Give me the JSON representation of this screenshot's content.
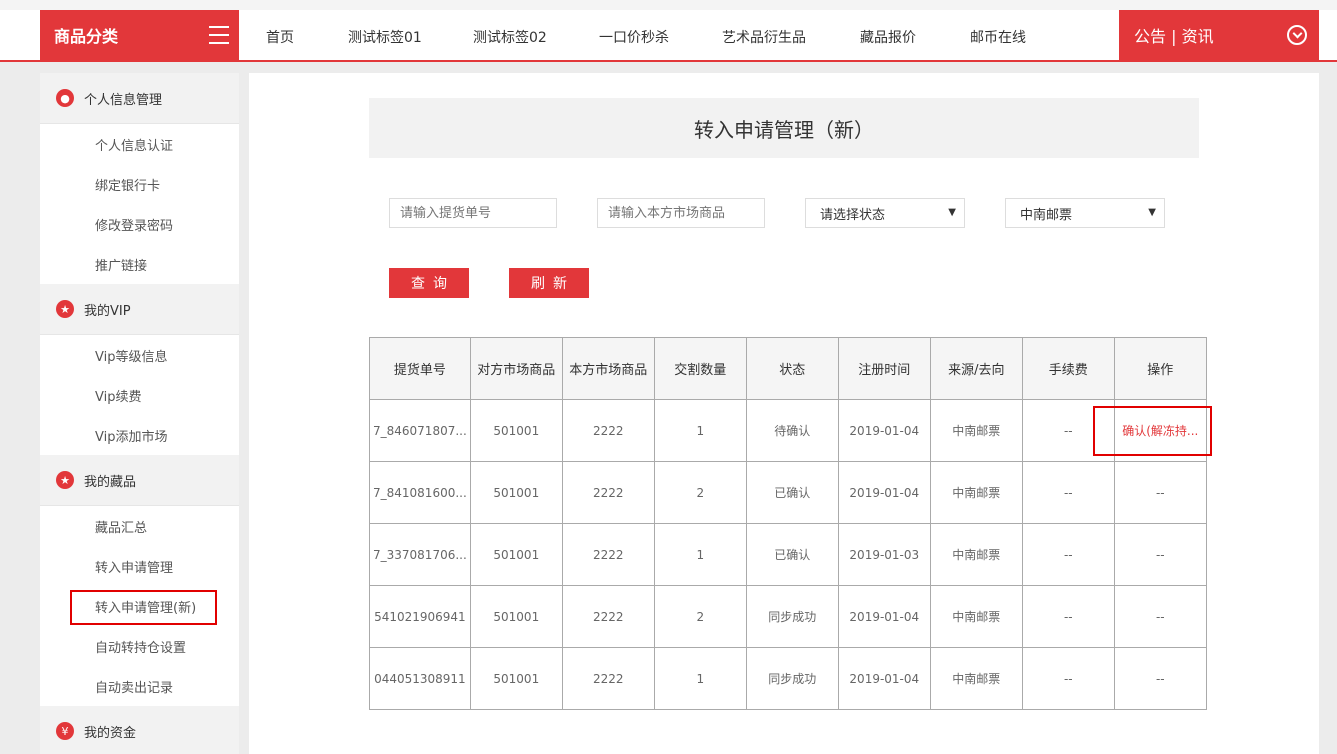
{
  "header": {
    "category_label": "商品分类",
    "nav": [
      "首页",
      "测试标签01",
      "测试标签02",
      "一口价秒杀",
      "艺术品衍生品",
      "藏品报价",
      "邮币在线"
    ],
    "notice_label": "公告 | 资讯"
  },
  "sidebar": {
    "sections": [
      {
        "label": "个人信息管理",
        "icon": "user-icon",
        "items": [
          "个人信息认证",
          "绑定银行卡",
          "修改登录密码",
          "推广链接"
        ]
      },
      {
        "label": "我的VIP",
        "icon": "star-icon",
        "items": [
          "Vip等级信息",
          "Vip续费",
          "Vip添加市场"
        ]
      },
      {
        "label": "我的藏品",
        "icon": "star-icon",
        "items": [
          "藏品汇总",
          "转入申请管理",
          "转入申请管理(新)",
          "自动转持仓设置",
          "自动卖出记录"
        ]
      },
      {
        "label": "我的资金",
        "icon": "money-bag-icon",
        "items": []
      }
    ]
  },
  "main": {
    "title": "转入申请管理（新）",
    "search": {
      "pickup_placeholder": "请输入提货单号",
      "product_placeholder": "请输入本方市场商品",
      "status_selected": "请选择状态",
      "market_selected": "中南邮票"
    },
    "buttons": {
      "query": "查询",
      "refresh": "刷新"
    },
    "table": {
      "headers": [
        "提货单号",
        "对方市场商品",
        "本方市场商品",
        "交割数量",
        "状态",
        "注册时间",
        "来源/去向",
        "手续费",
        "操作"
      ],
      "rows": [
        [
          "7_846071807...",
          "501001",
          "2222",
          "1",
          "待确认",
          "2019-01-04",
          "中南邮票",
          "--",
          "确认(解冻持..."
        ],
        [
          "7_841081600...",
          "501001",
          "2222",
          "2",
          "已确认",
          "2019-01-04",
          "中南邮票",
          "--",
          "--"
        ],
        [
          "7_337081706...",
          "501001",
          "2222",
          "1",
          "已确认",
          "2019-01-03",
          "中南邮票",
          "--",
          "--"
        ],
        [
          "541021906941",
          "501001",
          "2222",
          "2",
          "同步成功",
          "2019-01-04",
          "中南邮票",
          "--",
          "--"
        ],
        [
          "044051308911",
          "501001",
          "2222",
          "1",
          "同步成功",
          "2019-01-04",
          "中南邮票",
          "--",
          "--"
        ]
      ]
    }
  },
  "colors": {
    "accent": "#e2373a",
    "highlight": "#e10000"
  }
}
